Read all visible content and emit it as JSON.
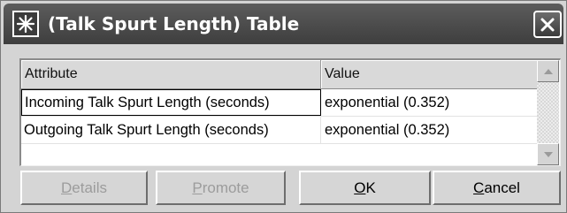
{
  "window": {
    "title": "(Talk Spurt Length) Table",
    "title_icon": "asterisk-star-icon",
    "close_icon": "close-icon"
  },
  "table": {
    "columns": [
      "Attribute",
      "Value"
    ],
    "rows": [
      {
        "attribute": "Incoming Talk Spurt Length (seconds)",
        "value": "exponential (0.352)"
      },
      {
        "attribute": "Outgoing Talk Spurt Length (seconds)",
        "value": "exponential (0.352)"
      }
    ]
  },
  "buttons": {
    "details": {
      "mnemonic": "D",
      "rest": "etails",
      "enabled": false
    },
    "promote": {
      "mnemonic": "P",
      "rest": "romote",
      "enabled": false
    },
    "ok": {
      "mnemonic": "O",
      "rest": "K",
      "enabled": true
    },
    "cancel": {
      "mnemonic": "C",
      "rest": "ancel",
      "enabled": true
    }
  },
  "colors": {
    "titlebar": "#4a4a4a",
    "dialog_bg": "#d4d4d4",
    "disabled_text": "#9c9c9c"
  }
}
